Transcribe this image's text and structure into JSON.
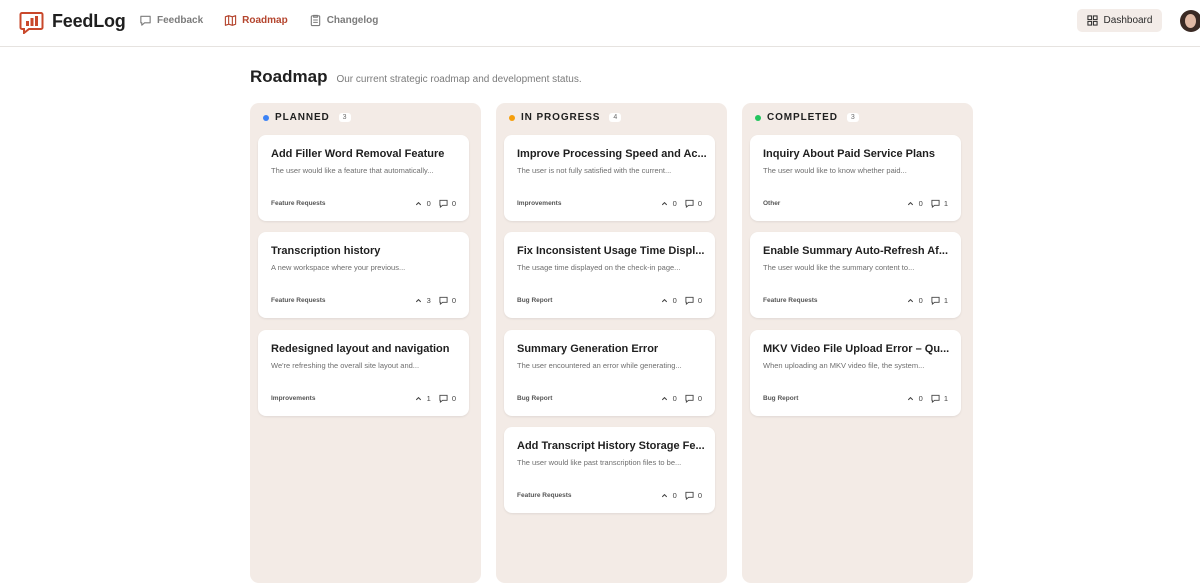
{
  "brand": {
    "name": "FeedLog",
    "color": "#c9482b"
  },
  "nav": [
    {
      "label": "Feedback",
      "icon": "chat-icon",
      "active": false
    },
    {
      "label": "Roadmap",
      "icon": "map-icon",
      "active": true
    },
    {
      "label": "Changelog",
      "icon": "clipboard-icon",
      "active": false
    }
  ],
  "header": {
    "dashboard_label": "Dashboard"
  },
  "page": {
    "title": "Roadmap",
    "subtitle": "Our current strategic roadmap and development status."
  },
  "columns": [
    {
      "title": "PLANNED",
      "count": "3",
      "color": "#3b82f6",
      "cards": [
        {
          "title": "Add Filler Word Removal Feature",
          "desc": "The user would like a feature that automatically...",
          "tag": "Feature Requests",
          "votes": "0",
          "comments": "0"
        },
        {
          "title": "Transcription history",
          "desc": "A new workspace where your previous...",
          "tag": "Feature Requests",
          "votes": "3",
          "comments": "0"
        },
        {
          "title": "Redesigned layout and navigation",
          "desc": "We're refreshing the overall site layout and...",
          "tag": "Improvements",
          "votes": "1",
          "comments": "0"
        }
      ]
    },
    {
      "title": "IN PROGRESS",
      "count": "4",
      "color": "#f59e0b",
      "cards": [
        {
          "title": "Improve Processing Speed and Ac...",
          "desc": "The user is not fully satisfied with the current...",
          "tag": "Improvements",
          "votes": "0",
          "comments": "0"
        },
        {
          "title": "Fix Inconsistent Usage Time Displ...",
          "desc": "The usage time displayed on the check-in page...",
          "tag": "Bug Report",
          "votes": "0",
          "comments": "0"
        },
        {
          "title": "Summary Generation Error",
          "desc": "The user encountered an error while generating...",
          "tag": "Bug Report",
          "votes": "0",
          "comments": "0"
        },
        {
          "title": "Add Transcript History Storage Fe...",
          "desc": "The user would like past transcription files to be...",
          "tag": "Feature Requests",
          "votes": "0",
          "comments": "0"
        }
      ]
    },
    {
      "title": "COMPLETED",
      "count": "3",
      "color": "#22c55e",
      "cards": [
        {
          "title": "Inquiry About Paid Service Plans",
          "desc": "The user would like to know whether paid...",
          "tag": "Other",
          "votes": "0",
          "comments": "1"
        },
        {
          "title": "Enable Summary Auto-Refresh Af...",
          "desc": "The user would like the summary content to...",
          "tag": "Feature Requests",
          "votes": "0",
          "comments": "1"
        },
        {
          "title": "MKV Video File Upload Error – Qu...",
          "desc": "When uploading an MKV video file, the system...",
          "tag": "Bug Report",
          "votes": "0",
          "comments": "1"
        }
      ]
    }
  ]
}
